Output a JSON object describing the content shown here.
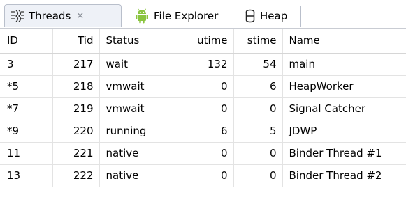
{
  "tabs": [
    {
      "label": "Threads",
      "icon": "threads-icon",
      "active": true,
      "close": "✕"
    },
    {
      "label": "File Explorer",
      "icon": "android-icon",
      "active": false
    },
    {
      "label": "Heap",
      "icon": "heap-icon",
      "active": false
    }
  ],
  "colors": {
    "android_green": "#8ac43f",
    "tab_active_bg": "#eef1f7",
    "border": "#c9ccd3"
  },
  "table": {
    "columns": [
      "ID",
      "Tid",
      "Status",
      "utime",
      "stime",
      "Name"
    ],
    "rows": [
      [
        "3",
        "217",
        "wait",
        "132",
        "54",
        "main"
      ],
      [
        "*5",
        "218",
        "vmwait",
        "0",
        "6",
        "HeapWorker"
      ],
      [
        "*7",
        "219",
        "vmwait",
        "0",
        "0",
        "Signal Catcher"
      ],
      [
        "*9",
        "220",
        "running",
        "6",
        "5",
        "JDWP"
      ],
      [
        "11",
        "221",
        "native",
        "0",
        "0",
        "Binder Thread #1"
      ],
      [
        "13",
        "222",
        "native",
        "0",
        "0",
        "Binder Thread #2"
      ]
    ]
  }
}
